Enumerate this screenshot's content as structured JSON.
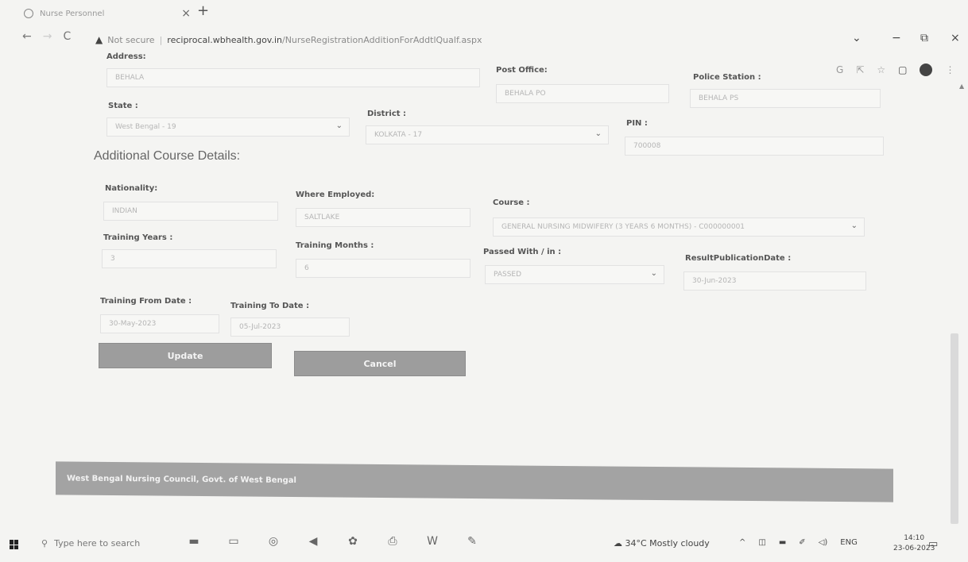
{
  "browser": {
    "tab_title": "Nurse Personnel",
    "tab_close": "×",
    "new_tab": "+",
    "back": "←",
    "forward": "→",
    "reload": "C",
    "not_secure": "Not secure",
    "host": "reciprocal.wbhealth.gov.in",
    "path": "/NurseRegistrationAdditionForAddtlQualf.aspx",
    "minimize": "−",
    "restore": "⧉",
    "close": "×",
    "chevron": "⌄"
  },
  "address": {
    "address_label": "Address:",
    "address_value": "BEHALA",
    "post_office_label": "Post Office:",
    "post_office_value": "BEHALA PO",
    "police_station_label": "Police Station :",
    "police_station_value": "BEHALA PS",
    "state_label": "State :",
    "state_value": "West Bengal - 19",
    "district_label": "District :",
    "district_value": "KOLKATA - 17",
    "pin_label": "PIN :",
    "pin_value": "700008"
  },
  "course": {
    "section_title": "Additional Course Details:",
    "nationality_label": "Nationality:",
    "nationality_value": "INDIAN",
    "where_employed_label": "Where Employed:",
    "where_employed_value": "SALTLAKE",
    "course_label": "Course :",
    "course_value": "GENERAL NURSING MIDWIFERY (3 YEARS 6 MONTHS) - C000000001",
    "training_years_label": "Training Years :",
    "training_years_value": "3",
    "training_months_label": "Training Months :",
    "training_months_value": "6",
    "passed_label": "Passed With / in :",
    "passed_value": "PASSED",
    "result_date_label": "ResultPublicationDate :",
    "result_date_value": "30-Jun-2023",
    "from_date_label": "Training From Date :",
    "from_date_value": "30-May-2023",
    "to_date_label": "Training To Date :",
    "to_date_value": "05-Jul-2023"
  },
  "actions": {
    "update_label": "Update",
    "cancel_label": "Cancel"
  },
  "footer": {
    "text": "West Bengal Nursing Council, Govt. of West Bengal"
  },
  "taskbar": {
    "search_placeholder": "Type here to search",
    "weather": "34°C  Mostly cloudy",
    "lang": "ENG",
    "time": "14:10",
    "date": "23-06-2023"
  }
}
